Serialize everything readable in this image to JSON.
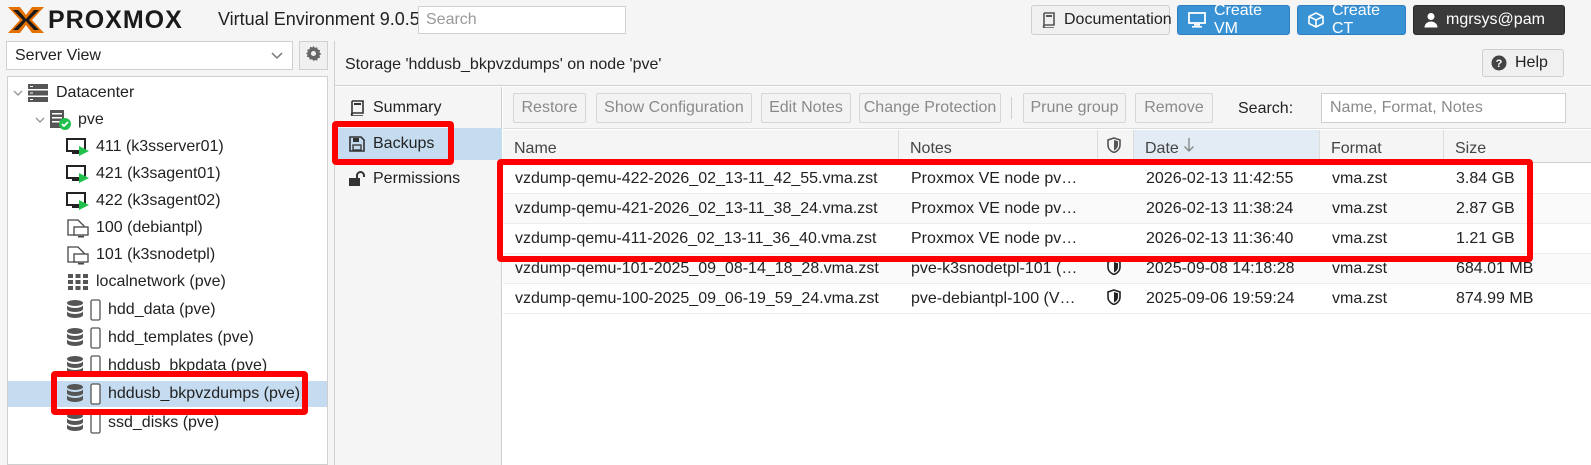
{
  "topbar": {
    "logo": "PROXMOX",
    "product": "Virtual Environment 9.0.5",
    "search_placeholder": "Search",
    "documentation_label": "Documentation",
    "create_vm_label": "Create VM",
    "create_ct_label": "Create CT",
    "user_label": "mgrsys@pam"
  },
  "left": {
    "view": "Server View",
    "tree": [
      {
        "label": "Datacenter",
        "icon": "datacenter-icon"
      },
      {
        "label": "pve",
        "icon": "node-icon"
      },
      {
        "label": "411 (k3sserver01)",
        "icon": "vm-running-icon"
      },
      {
        "label": "421 (k3sagent01)",
        "icon": "vm-running-icon"
      },
      {
        "label": "422 (k3sagent02)",
        "icon": "vm-running-icon"
      },
      {
        "label": "100 (debiantpl)",
        "icon": "vm-template-icon"
      },
      {
        "label": "101 (k3snodetpl)",
        "icon": "vm-template-icon"
      },
      {
        "label": "localnetwork (pve)",
        "icon": "network-icon"
      },
      {
        "label": "hdd_data (pve)",
        "icon": "storage-icon"
      },
      {
        "label": "hdd_templates (pve)",
        "icon": "storage-icon"
      },
      {
        "label": "hddusb_bkpdata (pve)",
        "icon": "storage-icon"
      },
      {
        "label": "hddusb_bkpvzdumps (pve)",
        "icon": "storage-icon"
      },
      {
        "label": "ssd_disks (pve)",
        "icon": "storage-icon"
      }
    ]
  },
  "content": {
    "title": "Storage 'hddusb_bkpvzdumps' on node 'pve'",
    "help_label": "Help",
    "nav": [
      {
        "label": "Summary",
        "icon": "book-icon"
      },
      {
        "label": "Backups",
        "icon": "floppy-icon"
      },
      {
        "label": "Permissions",
        "icon": "unlock-icon"
      }
    ],
    "toolbar": {
      "restore": "Restore",
      "show_config": "Show Configuration",
      "edit_notes": "Edit Notes",
      "change_protection": "Change Protection",
      "prune_group": "Prune group",
      "remove": "Remove",
      "search_label": "Search:",
      "search_placeholder": "Name, Format, Notes"
    },
    "grid": {
      "headers": {
        "name": "Name",
        "notes": "Notes",
        "date": "Date",
        "format": "Format",
        "size": "Size"
      },
      "rows": [
        {
          "name": "vzdump-qemu-422-2026_02_13-11_42_55.vma.zst",
          "notes": "Proxmox VE node pv…",
          "protected": false,
          "date": "2026-02-13 11:42:55",
          "format": "vma.zst",
          "size": "3.84 GB"
        },
        {
          "name": "vzdump-qemu-421-2026_02_13-11_38_24.vma.zst",
          "notes": "Proxmox VE node pv…",
          "protected": false,
          "date": "2026-02-13 11:38:24",
          "format": "vma.zst",
          "size": "2.87 GB"
        },
        {
          "name": "vzdump-qemu-411-2026_02_13-11_36_40.vma.zst",
          "notes": "Proxmox VE node pv…",
          "protected": false,
          "date": "2026-02-13 11:36:40",
          "format": "vma.zst",
          "size": "1.21 GB"
        },
        {
          "name": "vzdump-qemu-101-2025_09_08-14_18_28.vma.zst",
          "notes": "pve-k3snodetpl-101 (…",
          "protected": true,
          "date": "2025-09-08 14:18:28",
          "format": "vma.zst",
          "size": "684.01 MB"
        },
        {
          "name": "vzdump-qemu-100-2025_09_06-19_59_24.vma.zst",
          "notes": "pve-debiantpl-100 (V…",
          "protected": true,
          "date": "2025-09-06 19:59:24",
          "format": "vma.zst",
          "size": "874.99 MB"
        }
      ]
    }
  },
  "colors": {
    "accent": "#3892d4",
    "brand": "#e57000",
    "highlight": "#ff0000",
    "selection": "#c5dcf0"
  }
}
